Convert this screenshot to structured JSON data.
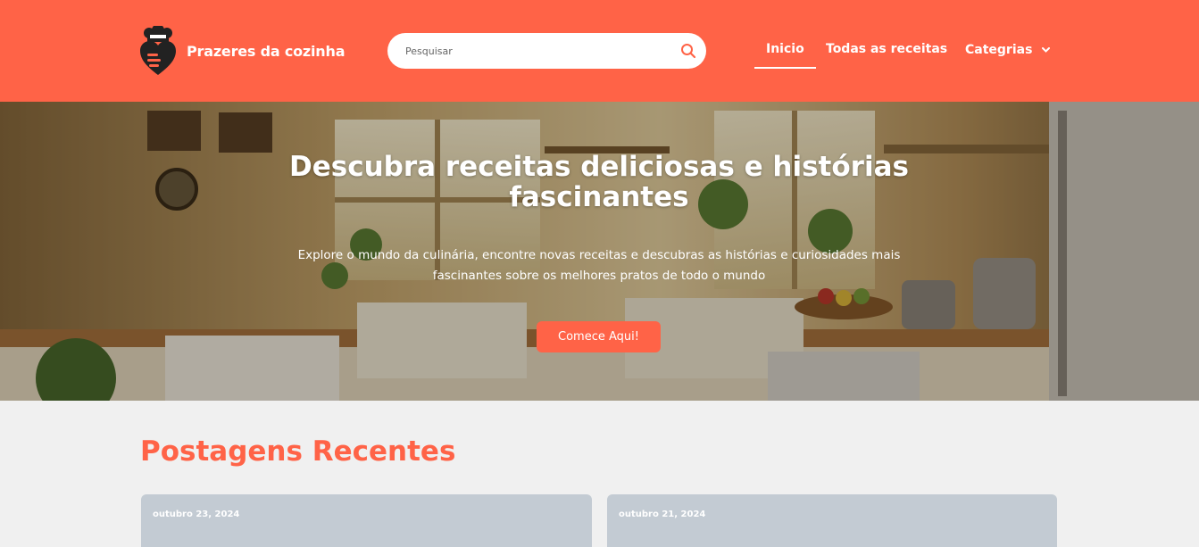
{
  "header": {
    "brand": "Prazeres da cozinha",
    "search_placeholder": "Pesquisar",
    "nav": {
      "home": "Inicio",
      "all_recipes": "Todas as receitas",
      "categories": "Categrias"
    }
  },
  "hero": {
    "title": "Descubra receitas deliciosas e histórias fascinantes",
    "subtitle": "Explore o mundo da culinária, encontre novas receitas e descubras as histórias e curiosidades mais fascinantes sobre os melhores pratos de todo o mundo",
    "cta": "Comece Aqui!"
  },
  "posts": {
    "title": "Postagens Recentes",
    "items": [
      {
        "date": "outubro 23, 2024"
      },
      {
        "date": "outubro 21, 2024"
      }
    ]
  },
  "colors": {
    "accent": "#ff6347",
    "card": "#c3cbd3",
    "background": "#f0f0f0"
  },
  "icons": {
    "logo": "chef-heart-logo",
    "search": "search-icon",
    "dropdown": "chevron-down-icon"
  }
}
